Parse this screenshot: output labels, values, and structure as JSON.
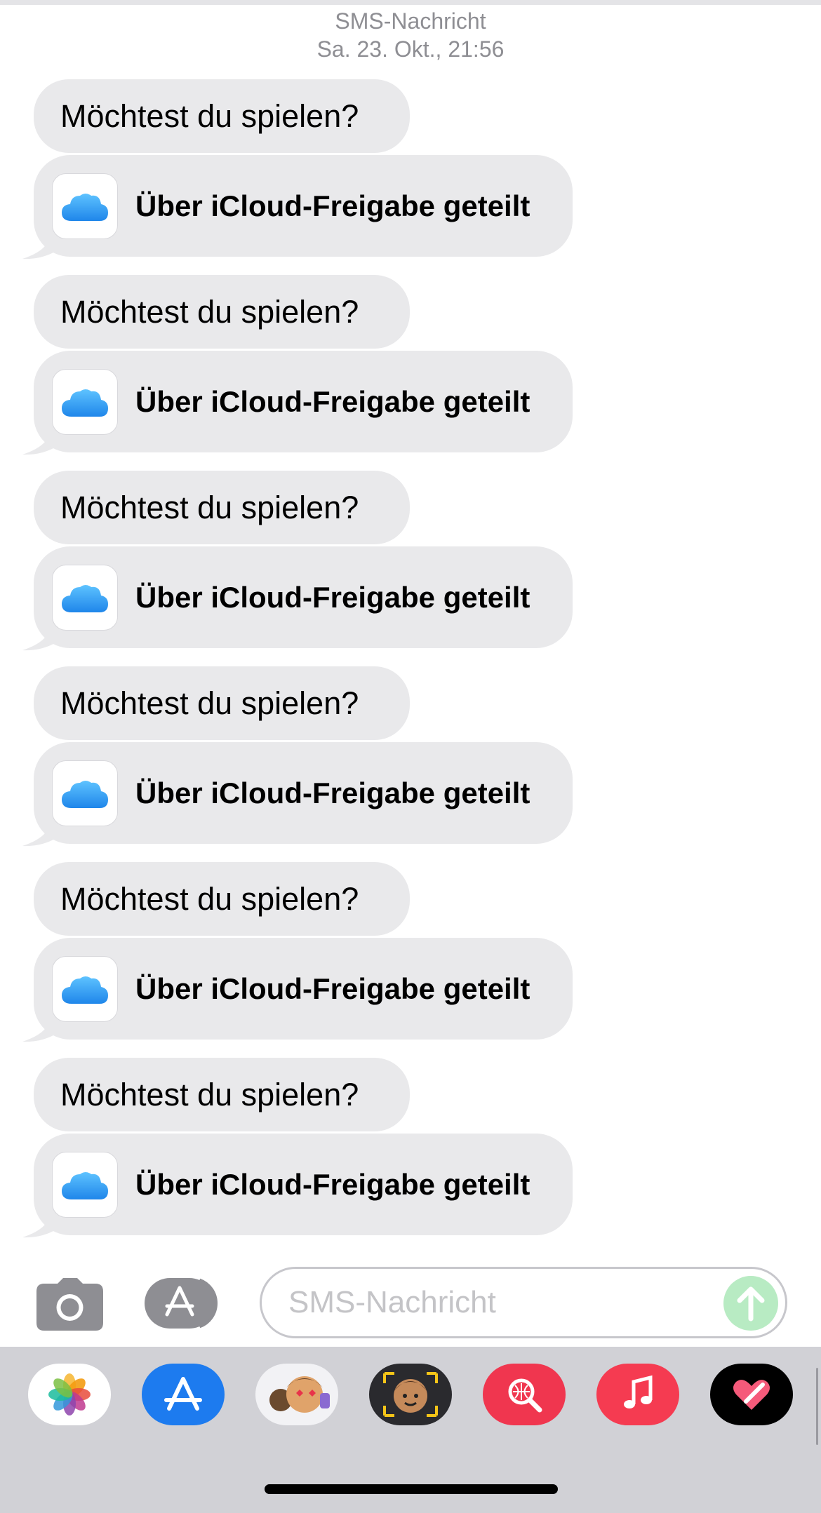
{
  "header": {
    "service": "SMS-Nachricht",
    "timestamp": "Sa. 23. Okt., 21:56"
  },
  "messages": [
    {
      "text": "Möchtest du spielen?",
      "link_label": "Über iCloud-Freigabe geteilt"
    },
    {
      "text": "Möchtest du spielen?",
      "link_label": "Über iCloud-Freigabe geteilt"
    },
    {
      "text": "Möchtest du spielen?",
      "link_label": "Über iCloud-Freigabe geteilt"
    },
    {
      "text": "Möchtest du spielen?",
      "link_label": "Über iCloud-Freigabe geteilt"
    },
    {
      "text": "Möchtest du spielen?",
      "link_label": "Über iCloud-Freigabe geteilt"
    },
    {
      "text": "Möchtest du spielen?",
      "link_label": "Über iCloud-Freigabe geteilt"
    }
  ],
  "composer": {
    "placeholder": "SMS-Nachricht"
  },
  "icons": {
    "link": "icloud-icon",
    "camera": "camera-icon",
    "apps": "app-store-icon",
    "send": "send-arrow-icon"
  },
  "app_drawer": [
    {
      "name": "photos-app-icon"
    },
    {
      "name": "app-store-app-icon"
    },
    {
      "name": "memoji-stickers-app-icon"
    },
    {
      "name": "animoji-app-icon"
    },
    {
      "name": "image-search-app-icon"
    },
    {
      "name": "music-app-icon"
    },
    {
      "name": "digital-touch-app-icon"
    }
  ],
  "colors": {
    "bubble_gray": "#e9e9eb",
    "meta_gray": "#8e8e93",
    "send_green": "#b8ebc3",
    "drawer_bg": "#d1d1d6",
    "icloud_blue": "#2e9cf2"
  }
}
